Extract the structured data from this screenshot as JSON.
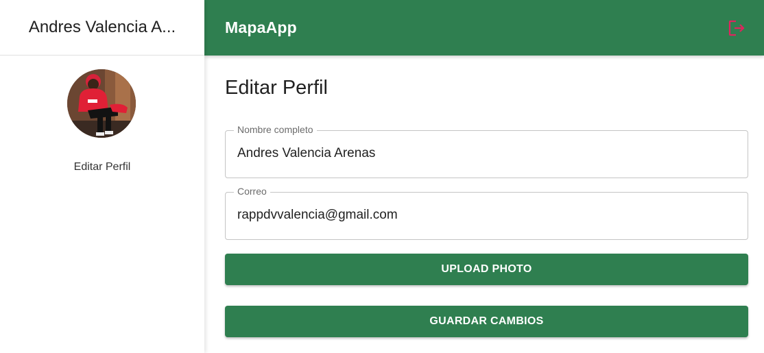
{
  "sidebar": {
    "username": "Andres Valencia A...",
    "avatar_icon": "profile-photo",
    "items": [
      {
        "label": "Editar Perfil"
      }
    ]
  },
  "topbar": {
    "title": "MapaApp",
    "logout_icon": "logout-icon",
    "logout_color": "#e0245e"
  },
  "main": {
    "title": "Editar Perfil",
    "fields": {
      "name": {
        "label": "Nombre completo",
        "value": "Andres Valencia Arenas"
      },
      "email": {
        "label": "Correo",
        "value": "rappdvvalencia@gmail.com"
      }
    },
    "buttons": {
      "upload": "UPLOAD PHOTO",
      "save": "GUARDAR CAMBIOS"
    }
  },
  "colors": {
    "primary": "#2f7f50",
    "text": "#212121",
    "border": "#c4c4c4"
  }
}
